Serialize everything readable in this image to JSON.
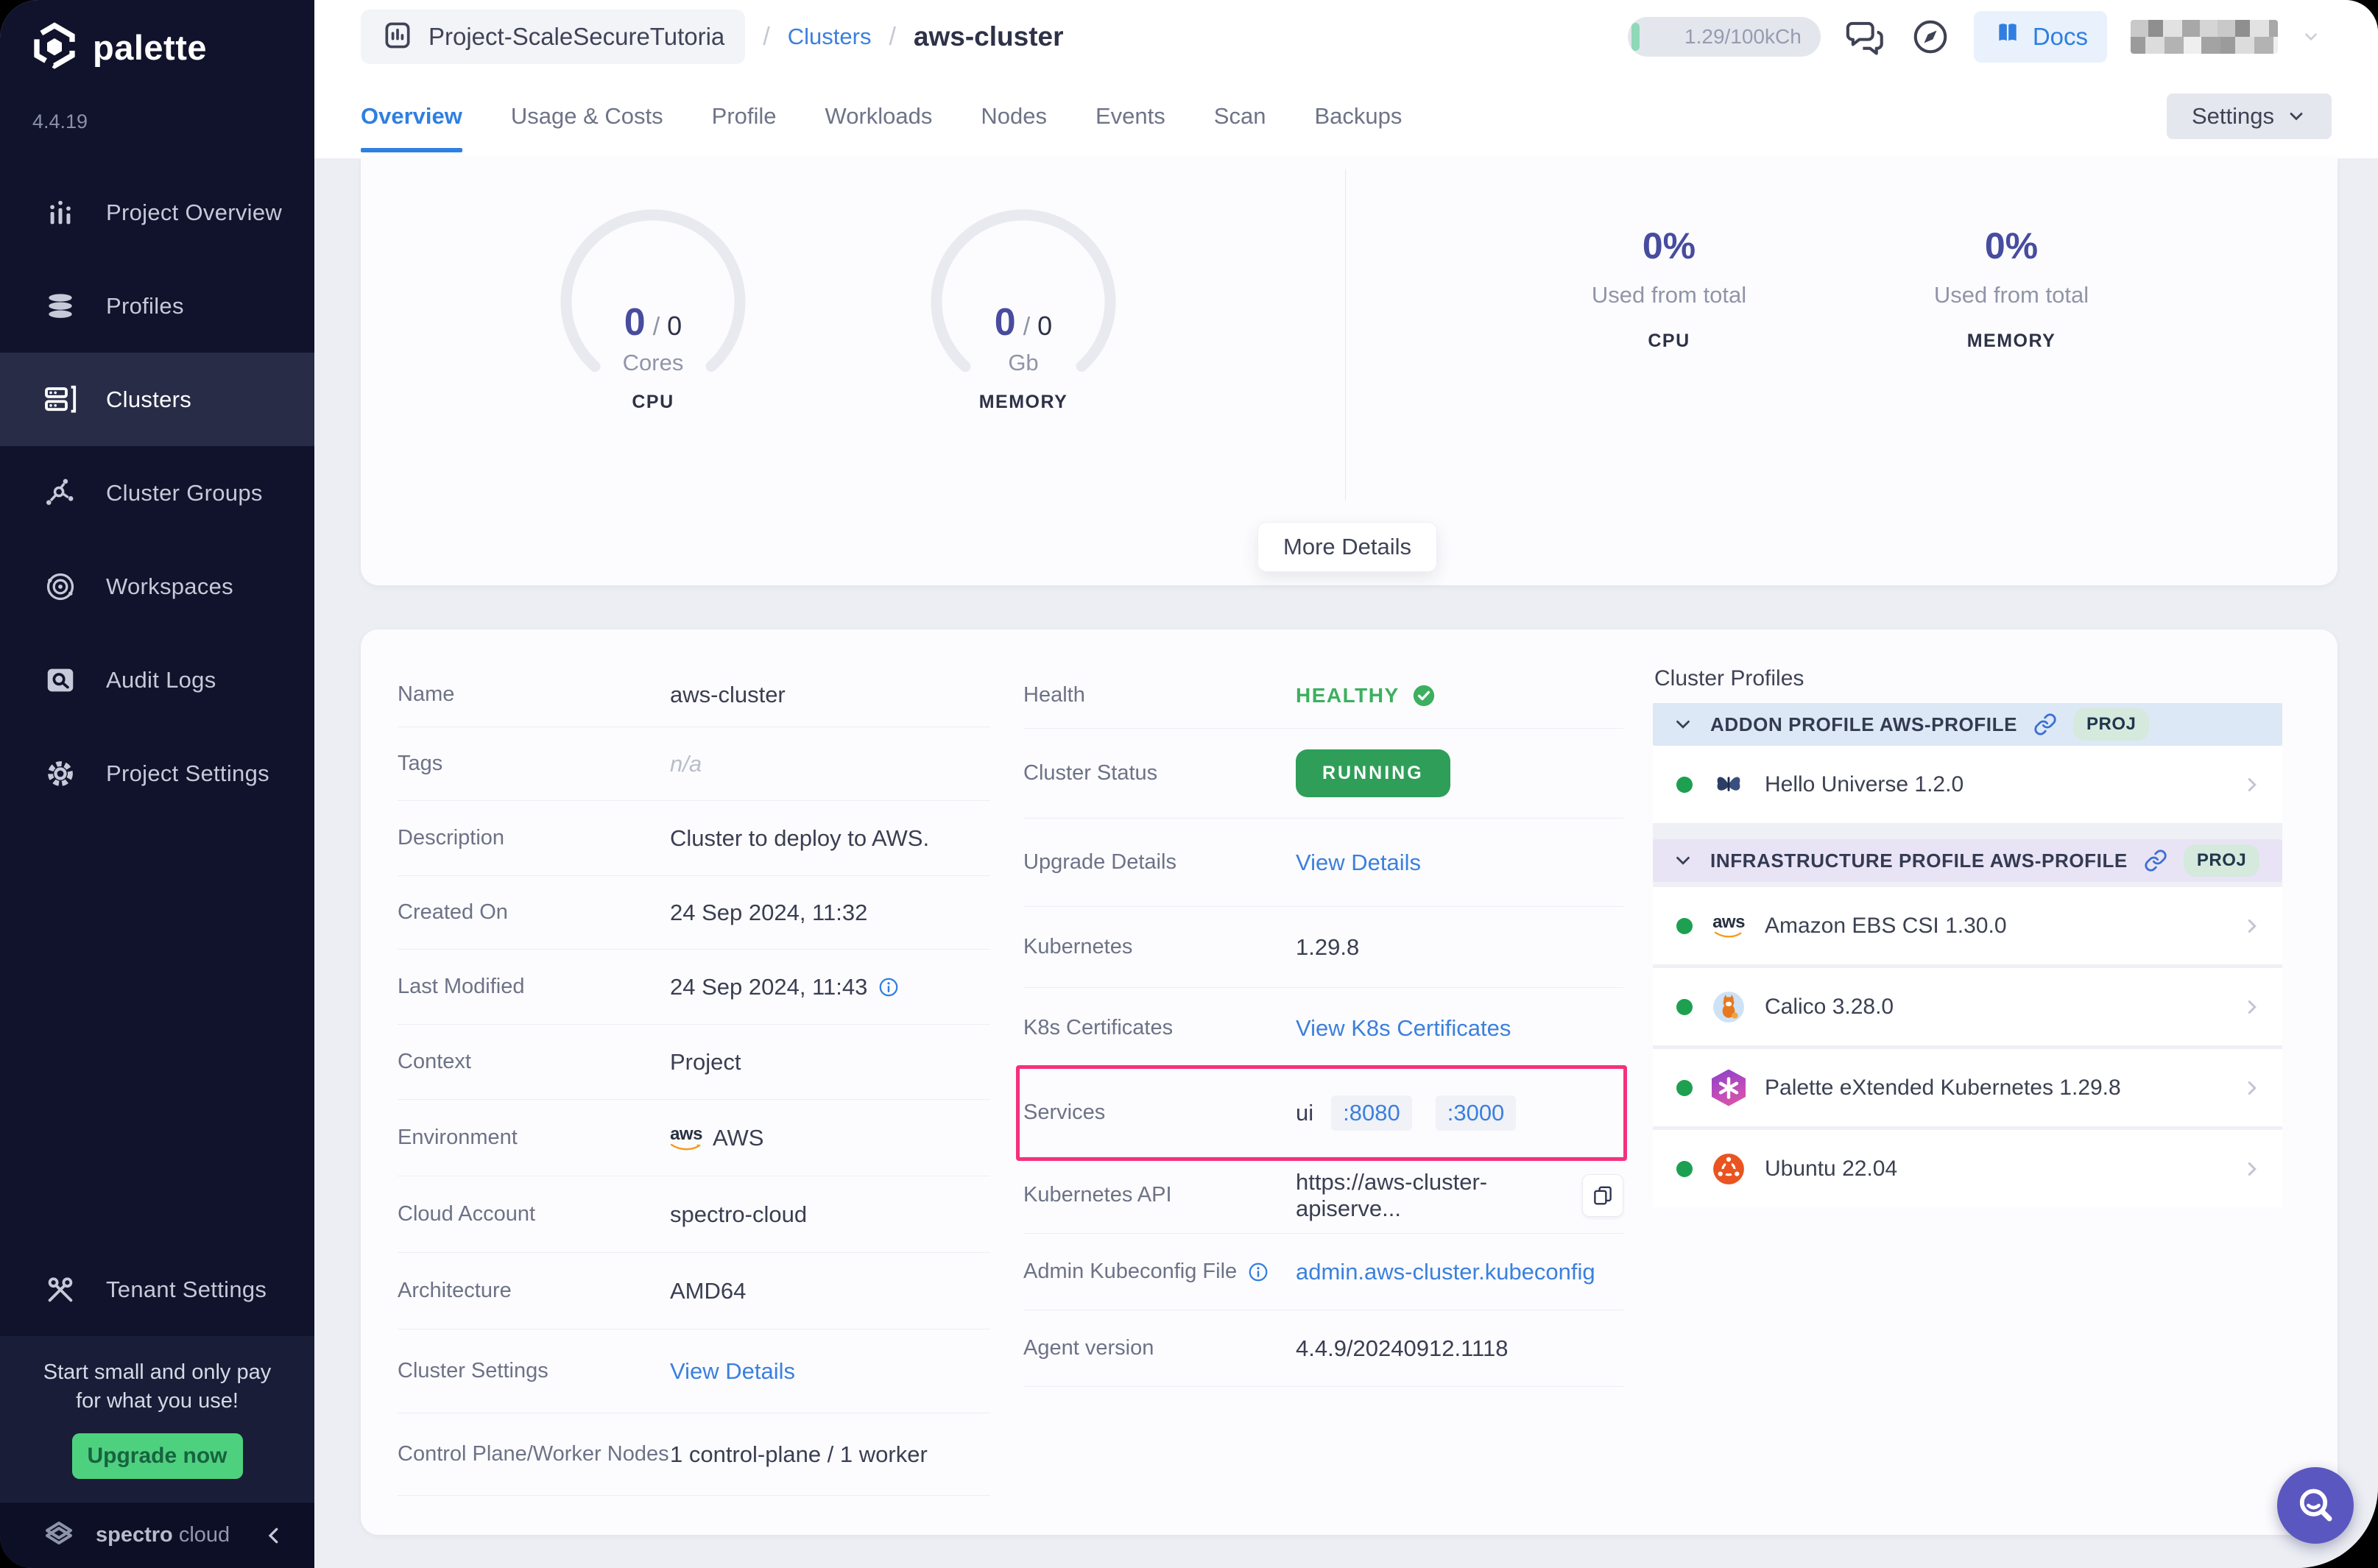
{
  "colors": {
    "accent_purple": "#474c9f",
    "link_blue": "#3b80dd",
    "active_tab_blue": "#2f7fe0",
    "green_status": "#2f9e58",
    "healthy_green": "#3cb05f",
    "pink_highlight": "#f5307d",
    "sidebar_bg": "#10132b",
    "upgrade_green": "#4ed17e"
  },
  "sidebar": {
    "brand": "palette",
    "version": "4.4.19",
    "items": [
      {
        "label": "Project Overview"
      },
      {
        "label": "Profiles"
      },
      {
        "label": "Clusters"
      },
      {
        "label": "Cluster Groups"
      },
      {
        "label": "Workspaces"
      },
      {
        "label": "Audit Logs"
      },
      {
        "label": "Project Settings"
      }
    ],
    "active_item": "Clusters",
    "tenant_settings": "Tenant Settings",
    "promo": {
      "line1": "Start small and only pay",
      "line2": "for what you use!",
      "button": "Upgrade now"
    },
    "footer": {
      "brand_bold": "spectro",
      "brand_light": "cloud"
    }
  },
  "header": {
    "project": "Project-ScaleSecureTutoria",
    "separator": "/",
    "clusters_link": "Clusters",
    "cluster_name": "aws-cluster",
    "usage": "1.29/100kCh",
    "docs": "Docs"
  },
  "tabs": {
    "items": [
      "Overview",
      "Usage & Costs",
      "Profile",
      "Workloads",
      "Nodes",
      "Events",
      "Scan",
      "Backups"
    ],
    "active": "Overview",
    "settings": "Settings"
  },
  "overview": {
    "cpu_gauge": {
      "used": "0",
      "sep": "/",
      "total": "0",
      "unit": "Cores",
      "label": "CPU"
    },
    "memory_gauge": {
      "used": "0",
      "sep": "/",
      "total": "0",
      "unit": "Gb",
      "label": "MEMORY"
    },
    "cpu_stat": {
      "value": "0%",
      "caption": "Used from total",
      "label": "CPU"
    },
    "memory_stat": {
      "value": "0%",
      "caption": "Used from total",
      "label": "MEMORY"
    },
    "more_details": "More Details"
  },
  "details": {
    "left": [
      {
        "label": "Name",
        "value": "aws-cluster"
      },
      {
        "label": "Tags",
        "value": "n/a"
      },
      {
        "label": "Description",
        "value": "Cluster to deploy to AWS."
      },
      {
        "label": "Created On",
        "value": "24 Sep 2024, 11:32"
      },
      {
        "label": "Last Modified",
        "value": "24 Sep 2024, 11:43"
      },
      {
        "label": "Context",
        "value": "Project"
      },
      {
        "label": "Environment",
        "value": "AWS"
      },
      {
        "label": "Cloud Account",
        "value": "spectro-cloud"
      },
      {
        "label": "Architecture",
        "value": "AMD64"
      },
      {
        "label": "Cluster Settings",
        "value": "View Details"
      },
      {
        "label": "Control Plane/Worker Nodes",
        "value": "1 control-plane / 1 worker"
      }
    ],
    "mid": {
      "health": {
        "label": "Health",
        "value": "HEALTHY"
      },
      "status": {
        "label": "Cluster Status",
        "value": "RUNNING"
      },
      "upgrade": {
        "label": "Upgrade Details",
        "value": "View Details"
      },
      "kubernetes": {
        "label": "Kubernetes",
        "value": "1.29.8"
      },
      "certificates": {
        "label": "K8s Certificates",
        "value": "View K8s Certificates"
      },
      "services": {
        "label": "Services",
        "prefix": "ui",
        "port1": ":8080",
        "port2": ":3000"
      },
      "api": {
        "label": "Kubernetes API",
        "value": "https://aws-cluster-apiserve..."
      },
      "kubeconfig": {
        "label": "Admin Kubeconfig File",
        "value": "admin.aws-cluster.kubeconfig"
      },
      "agent": {
        "label": "Agent version",
        "value": "4.4.9/20240912.1118"
      }
    }
  },
  "profiles": {
    "title": "Cluster Profiles",
    "badge": "PROJ",
    "addon": {
      "header": "ADDON PROFILE AWS-PROFILE",
      "items": [
        {
          "name": "Hello Universe 1.2.0"
        }
      ]
    },
    "infra": {
      "header": "INFRASTRUCTURE PROFILE AWS-PROFILE",
      "items": [
        {
          "name": "Amazon EBS CSI 1.30.0"
        },
        {
          "name": "Calico 3.28.0"
        },
        {
          "name": "Palette eXtended Kubernetes 1.29.8"
        },
        {
          "name": "Ubuntu 22.04"
        }
      ]
    }
  }
}
